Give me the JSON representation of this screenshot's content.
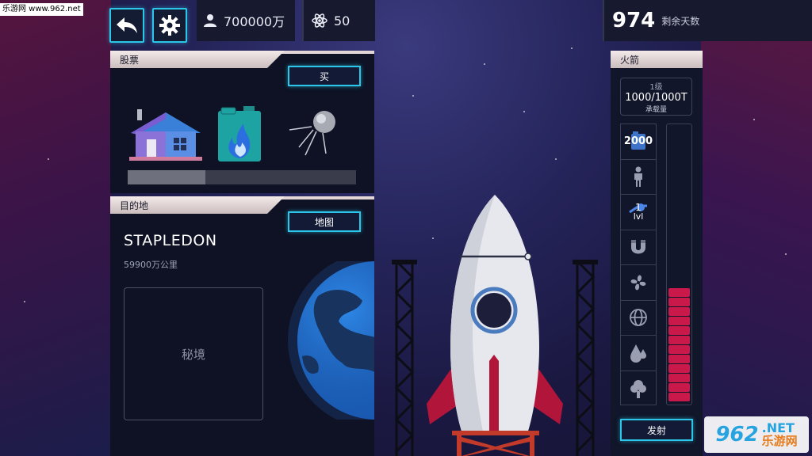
{
  "watermark": "乐游网 www.962.net",
  "topbar": {
    "money": "700000万",
    "atoms": "50",
    "days_remaining": "974",
    "days_label": "剩余天数"
  },
  "stocks": {
    "title": "股票",
    "buy_label": "买",
    "progress": 0.34,
    "items": [
      "house-icon",
      "fuel-can-icon",
      "satellite-icon"
    ]
  },
  "destination": {
    "title": "目的地",
    "map_label": "地图",
    "name": "STAPLEDON",
    "distance": "59900万公里",
    "secret_label": "秘境"
  },
  "rocket": {
    "title": "火箭",
    "level": "1级",
    "capacity": "1000/1000T",
    "capacity_label": "承载量",
    "slot_fuel_value": "2000",
    "slot_level_value": "1",
    "slot_level_suffix": "lvl",
    "fuel_segments": 12,
    "launch_label": "发射",
    "icons": [
      "fuel-icon",
      "person-icon",
      "level-icon",
      "magnet-icon",
      "fan-icon",
      "globe-icon",
      "water-drops-icon",
      "tree-icon"
    ]
  },
  "logo": {
    "number": "962",
    "net": ".NET",
    "site": "乐游网"
  },
  "colors": {
    "accent": "#2bc6e8",
    "fuel": "#c8194a",
    "panel": "#0e1224"
  }
}
